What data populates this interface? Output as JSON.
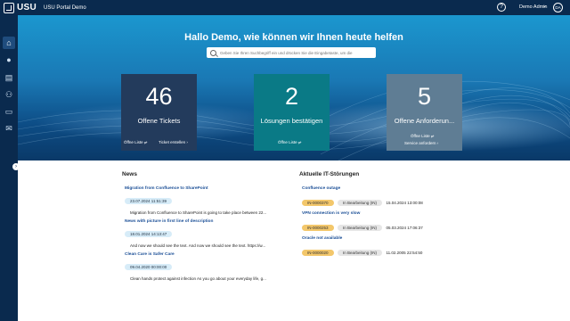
{
  "header": {
    "brand": "USU",
    "app_title": "USU Portal Demo",
    "help_glyph": "?",
    "user_name": "Demo Admin",
    "user_initials": "DA",
    "chevron": "⌄"
  },
  "sidebar": {
    "items": [
      {
        "icon": "home-icon",
        "glyph": "⌂"
      },
      {
        "icon": "person-icon",
        "glyph": "●"
      },
      {
        "icon": "list-icon",
        "glyph": "▤"
      },
      {
        "icon": "user-outline-icon",
        "glyph": "⚇"
      },
      {
        "icon": "inbox-icon",
        "glyph": "▭"
      },
      {
        "icon": "mail-icon",
        "glyph": "✉"
      }
    ],
    "toggle_glyph": "›"
  },
  "hero": {
    "title": "Hallo Demo, wie können wir Ihnen heute helfen",
    "search_placeholder": "Geben Sie Ihren Suchbegriff ein und drücken Sie die Eingabetaste, um die"
  },
  "tiles": [
    {
      "number": "46",
      "label": "Offene Tickets",
      "action1": "Öffne Liste  ⥂",
      "action2": "Ticket erstellen  ›",
      "color": "#233b5c"
    },
    {
      "number": "2",
      "label": "Lösungen bestätigen",
      "action1": "Öffne Liste  ⥂",
      "color": "#0a7a86"
    },
    {
      "number": "5",
      "label": "Offene Anforderun...",
      "action1": "Öffne Liste  ⥂",
      "action2": "Service anfordern  ›",
      "color": "#5f7d94"
    }
  ],
  "news": {
    "title": "News",
    "items": [
      {
        "title": "Migration from Confluence to SharePoint",
        "date": "23.07.2024 11:51:39",
        "text": "Migration from Confluence to SharePoint is going to take place between 22..."
      },
      {
        "title": "News with picture in first line of description",
        "date": "18.01.2024 14:13:47",
        "text": "And now we should see the text. And now we should see the text. https://w..."
      },
      {
        "title": "Clean Care is Safer Care",
        "date": "09.04.2020 00:00:00",
        "text": "Clean hands protect against infection As you go about your everyday life, g..."
      }
    ]
  },
  "incidents": {
    "title": "Aktuelle IT-Störungen",
    "items": [
      {
        "title": "Confluence outage",
        "id": "IN-0000370",
        "status": "In Bearbeitung (IN)",
        "date": "15.04.2024 13:00:08"
      },
      {
        "title": "VPN connection is very slow",
        "id": "IN-0000253",
        "status": "In Bearbeitung (IN)",
        "date": "05.03.2024 17:06:37"
      },
      {
        "title": "Oracle not available",
        "id": "IN-0000020",
        "status": "In Bearbeitung (IN)",
        "date": "11.02.2005 22:54:50"
      }
    ]
  }
}
